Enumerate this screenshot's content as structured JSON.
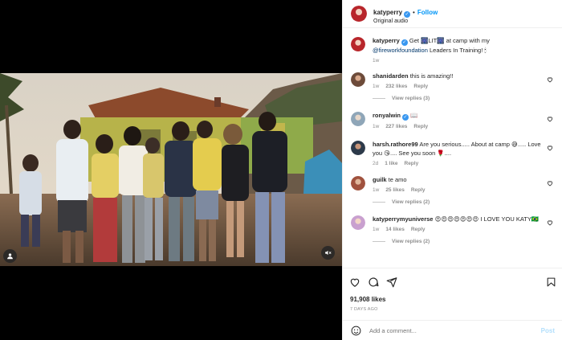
{
  "header": {
    "username": "katyperry",
    "follow_label": "Follow",
    "subtitle": "Original audio"
  },
  "caption": {
    "username": "katyperry",
    "text_pre": "Get 🎆LIT🎆 at camp with my ",
    "mention": "@fireworkfoundation",
    "text_post": " Leaders In Training! 🕯",
    "time": "1w"
  },
  "comments": [
    {
      "username": "shanidarden",
      "text": "this is amazing!!",
      "time": "1w",
      "likes": "232 likes",
      "reply": "Reply",
      "view_replies": "View replies (3)"
    },
    {
      "username": "ronyalwin",
      "verified": true,
      "text": "📖",
      "time": "1w",
      "likes": "227 likes",
      "reply": "Reply"
    },
    {
      "username": "harsh.rathore99",
      "text": "Are you serious..... About at camp 😅..... Love you 😘.... See you soon 🌹....",
      "time": "2d",
      "likes": "1 like",
      "reply": "Reply"
    },
    {
      "username": "guilk",
      "text": "te amo",
      "time": "1w",
      "likes": "25 likes",
      "reply": "Reply",
      "view_replies": "View replies (2)"
    },
    {
      "username": "katyperrymyuniverse",
      "text": "😍😍😍😍😍😍😍 I LOVE YOU KATY🇧🇷",
      "time": "1w",
      "likes": "14 likes",
      "reply": "Reply",
      "view_replies": "View replies (2)"
    }
  ],
  "footer": {
    "likes": "91,908 likes",
    "date": "7 DAYS AGO",
    "add_comment_placeholder": "Add a comment...",
    "post_label": "Post"
  },
  "colors": {
    "accent": "#0095f6",
    "verified": "#3897f0",
    "muted": "#8e8e8e"
  },
  "icons": [
    "person-tag-icon",
    "mute-icon",
    "heart-icon",
    "comment-icon",
    "share-icon",
    "save-icon",
    "emoji-icon",
    "verified-badge-icon"
  ]
}
